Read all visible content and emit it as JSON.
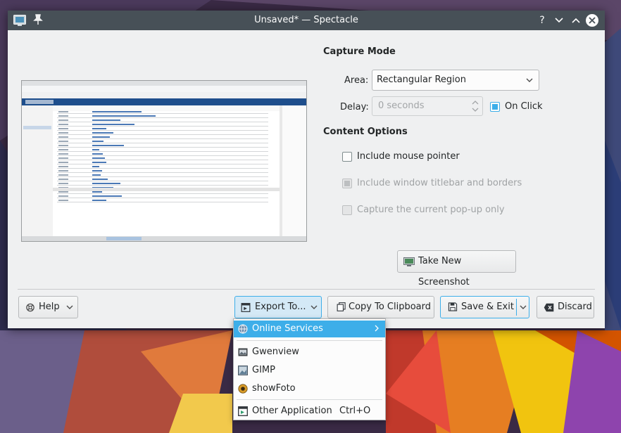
{
  "window": {
    "title": "Unsaved* — Spectacle",
    "buttons": [
      "?",
      "minimize",
      "maximize",
      "close"
    ]
  },
  "capture_mode": {
    "heading": "Capture Mode",
    "area_label": "Area:",
    "area_value": "Rectangular Region",
    "delay_label": "Delay:",
    "delay_value": "0 seconds",
    "on_click_label": "On Click",
    "on_click_checked": true
  },
  "content_options": {
    "heading": "Content Options",
    "include_mouse_pointer": {
      "label": "Include mouse pointer",
      "checked": false,
      "enabled": true
    },
    "include_titlebar": {
      "label": "Include window titlebar and borders",
      "checked": true,
      "enabled": false
    },
    "popup_only": {
      "label": "Capture the current pop-up only",
      "checked": false,
      "enabled": false
    }
  },
  "take_screenshot_label": "Take New Screenshot",
  "bottom_bar": {
    "help_label": "Help",
    "export_label": "Export To...",
    "copy_label": "Copy To Clipboard",
    "save_exit_label": "Save & Exit",
    "discard_label": "Discard"
  },
  "export_menu": {
    "items": [
      {
        "label": "Online Services",
        "icon": "globe-icon",
        "submenu": true,
        "highlighted": true
      },
      {
        "label": "Gwenview",
        "icon": "gwenview-icon"
      },
      {
        "label": "GIMP",
        "icon": "gimp-icon"
      },
      {
        "label": "showFoto",
        "icon": "showfoto-icon"
      },
      {
        "label": "Other Application",
        "icon": "application-icon",
        "shortcut": "Ctrl+O"
      }
    ]
  },
  "colors": {
    "accent": "#3daee9",
    "titlebar": "#475057",
    "window_bg": "#eff0f1"
  }
}
